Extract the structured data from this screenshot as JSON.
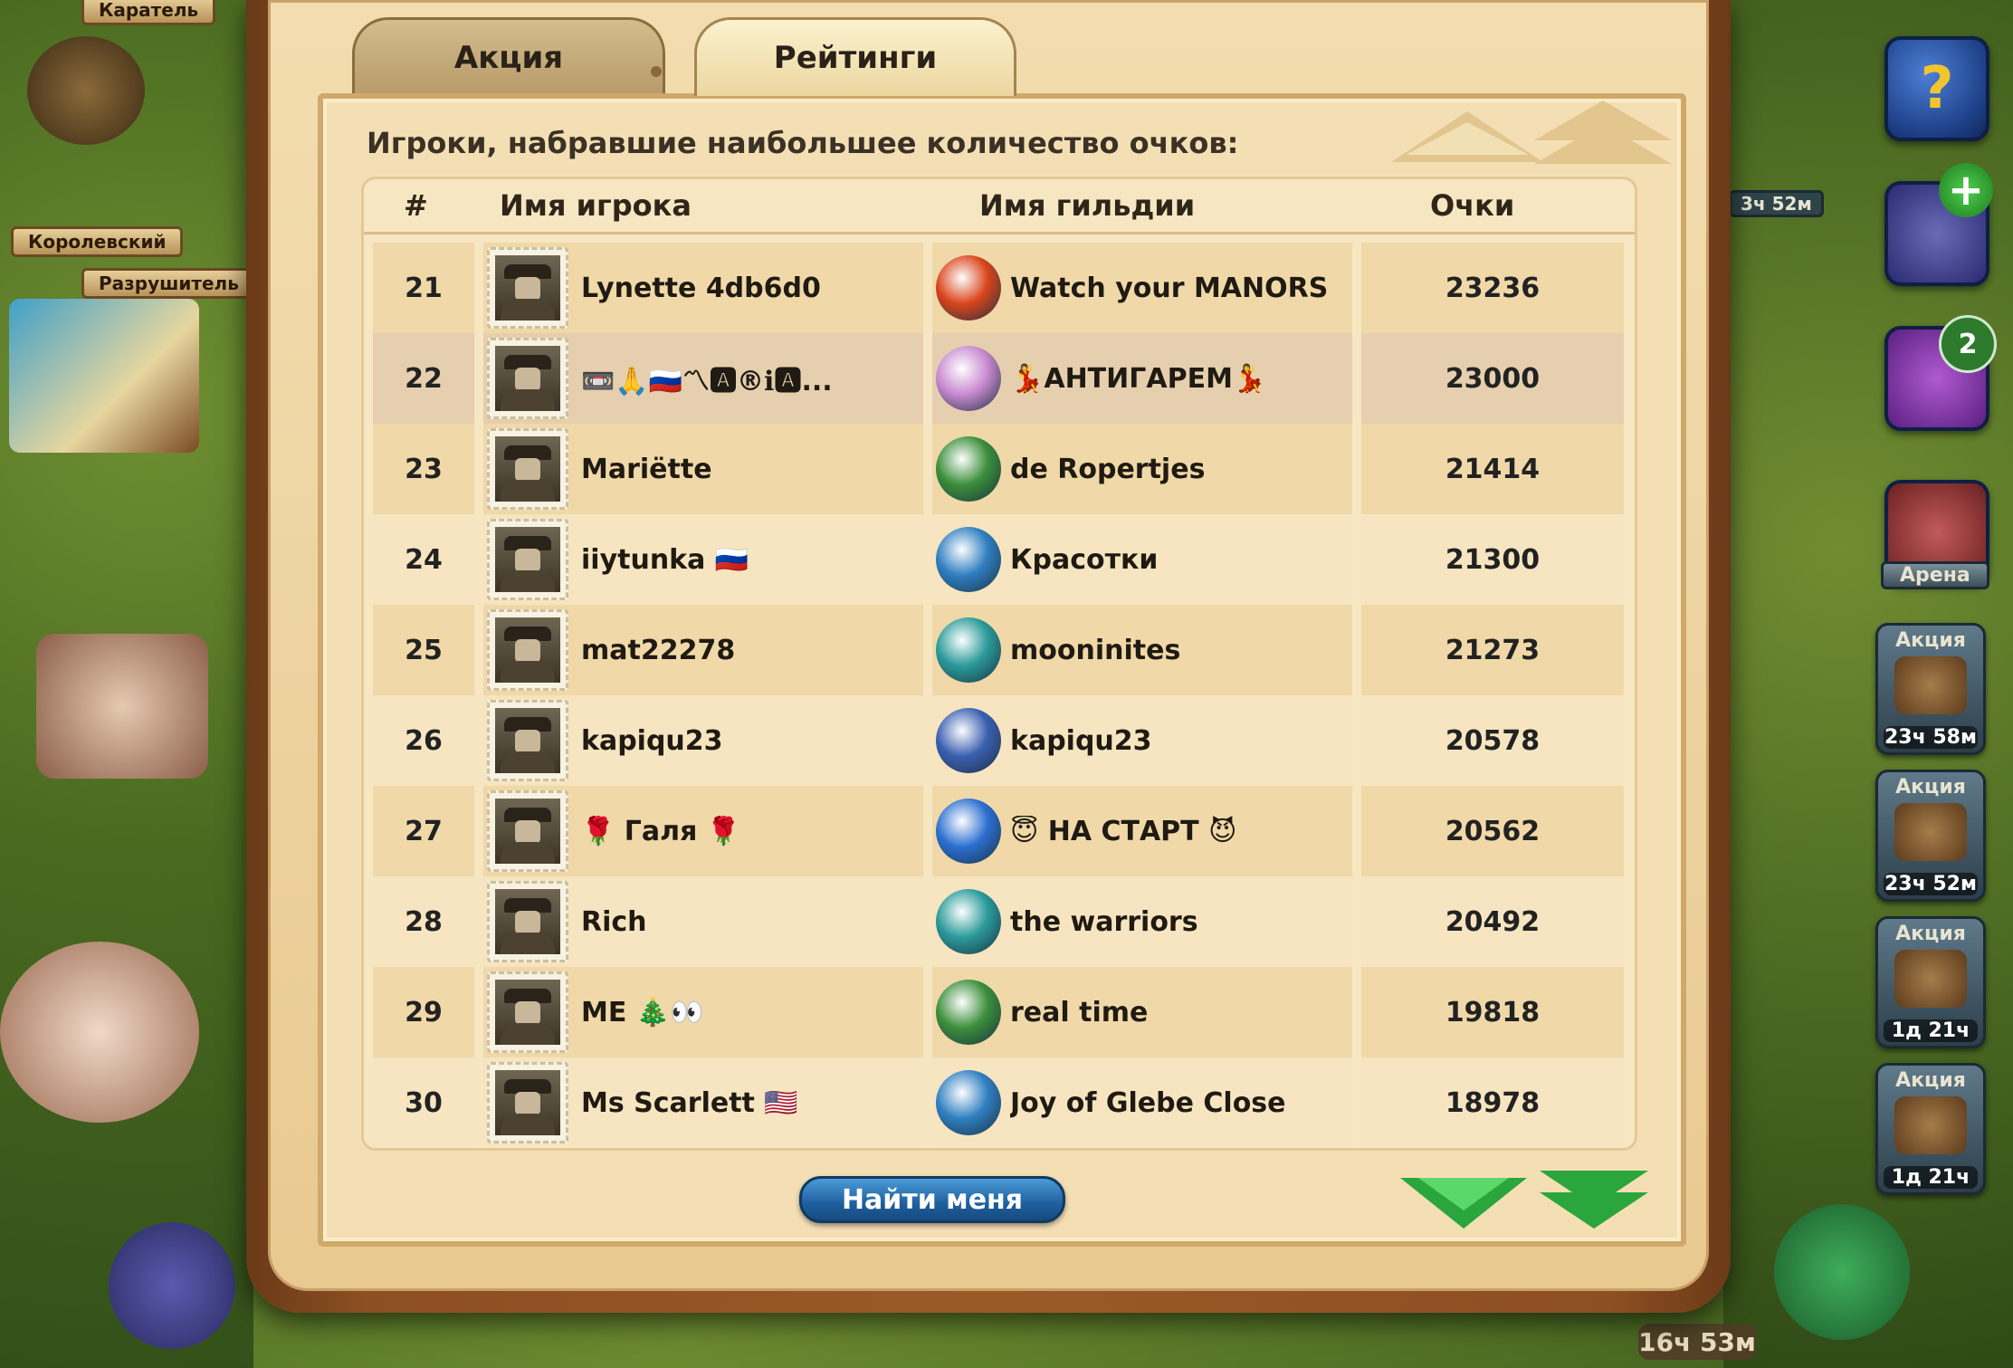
{
  "tabs": {
    "promo": "Акция",
    "ratings": "Рейтинги"
  },
  "panel": {
    "title": "Игроки, набравшие наибольшее количество очков:"
  },
  "table": {
    "headers": {
      "rank": "#",
      "player": "Имя игрока",
      "guild": "Имя гильдии",
      "score": "Очки"
    },
    "rows": [
      {
        "rank": "21",
        "player": "Lynette 4db6d0",
        "guild": "Watch your MANORS",
        "score": "23236",
        "guild_icon_color": "#d9451c"
      },
      {
        "rank": "22",
        "player": "📼🙏🇷🇺〽🅰®ℹ🅰...",
        "guild": "💃АНТИГАРЕМ💃",
        "score": "23000",
        "guild_icon_color": "#c88ad0",
        "highlighted": true
      },
      {
        "rank": "23",
        "player": "Mariëtte",
        "guild": "de Ropertjes",
        "score": "21414",
        "guild_icon_color": "#3b8f3b"
      },
      {
        "rank": "24",
        "player": "iiytunka 🇷🇺",
        "guild": "Красотки",
        "score": "21300",
        "guild_icon_color": "#2f7fc1"
      },
      {
        "rank": "25",
        "player": "mat22278",
        "guild": "mooninites",
        "score": "21273",
        "guild_icon_color": "#2a9a9a"
      },
      {
        "rank": "26",
        "player": "kapiqu23",
        "guild": "kapiqu23",
        "score": "20578",
        "guild_icon_color": "#3a5fb0"
      },
      {
        "rank": "27",
        "player": "🌹 Галя 🌹",
        "guild": "😇 НА СТАРТ 😈",
        "score": "20562",
        "guild_icon_color": "#2b6fd1"
      },
      {
        "rank": "28",
        "player": "Rich",
        "guild": "the warriors",
        "score": "20492",
        "guild_icon_color": "#2a9a9a"
      },
      {
        "rank": "29",
        "player": "ME 🎄👀",
        "guild": "real time",
        "score": "19818",
        "guild_icon_color": "#3b8f3b"
      },
      {
        "rank": "30",
        "player": "Ms Scarlett 🇺🇸",
        "guild": "Joy of Glebe Close",
        "score": "18978",
        "guild_icon_color": "#2f7fc1"
      }
    ]
  },
  "buttons": {
    "find_me": "Найти меня"
  },
  "background": {
    "signs": [
      "Каратель",
      "Королевский",
      "Разрушитель"
    ],
    "side_labels": {
      "arena": "Арена",
      "notification_count": "2",
      "timer_top": "3ч 52м"
    },
    "promos": [
      {
        "title": "Акция",
        "timer": "23ч 58м"
      },
      {
        "title": "Акция",
        "timer": "23ч 52м"
      },
      {
        "title": "Акция",
        "timer": "1д 21ч"
      },
      {
        "title": "Акция",
        "timer": "1д 21ч"
      }
    ],
    "bottom_timer": "16ч 53м"
  },
  "colors": {
    "frame_wood": "#8c4f22",
    "panel_bg": "#f4dfb5",
    "row_dark": "#f0d8a8",
    "row_light": "#f6e5c0",
    "row_highlight": "#e5cfae",
    "button_blue": "#1f5f9e",
    "arrow_green": "#2aa63c"
  }
}
